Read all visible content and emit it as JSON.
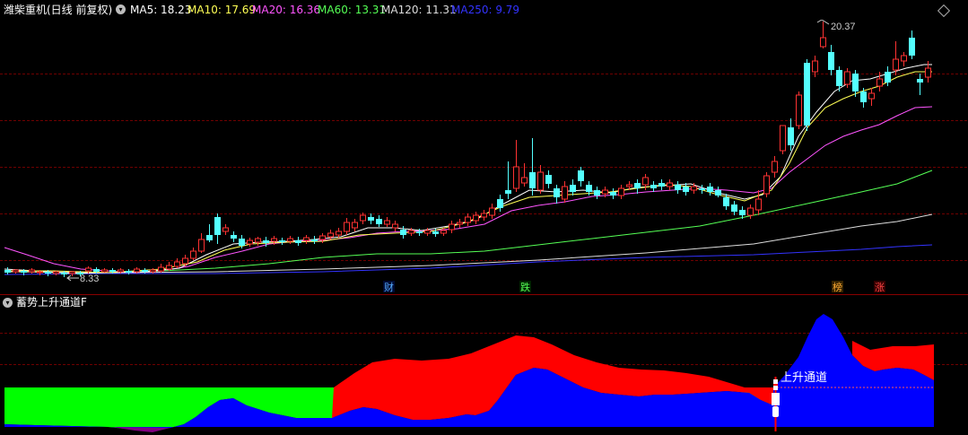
{
  "header": {
    "stock_title": "潍柴重机(日线 前复权)",
    "ma": [
      {
        "label": "MA5: 18.23",
        "color": "#ffffff"
      },
      {
        "label": "MA10: 17.69",
        "color": "#ffff55"
      },
      {
        "label": "MA20: 16.36",
        "color": "#ff55ff"
      },
      {
        "label": "MA60: 13.31",
        "color": "#55ff55"
      },
      {
        "label": "MA120: 11.31",
        "color": "#dddddd"
      },
      {
        "label": "MA250: 9.79",
        "color": "#3333ff"
      }
    ]
  },
  "main_chart": {
    "high_label": "20.37",
    "low_label": "8.33",
    "event_markers": [
      {
        "text": "财",
        "color": "#55aaff"
      },
      {
        "text": "跌",
        "color": "#55ff55"
      },
      {
        "text": "榜",
        "color": "#ffaa33"
      },
      {
        "text": "涨",
        "color": "#ff4444"
      }
    ]
  },
  "indicator": {
    "title": "蓄势上升通道F",
    "signal_label": "上升通道"
  },
  "colors": {
    "up": "#ff3232",
    "down": "#54ffff",
    "grid": "#6e0000",
    "green_area": "#00ff00",
    "red_area": "#ff0000",
    "blue_area": "#0000ff",
    "purple_area": "#800080"
  }
}
